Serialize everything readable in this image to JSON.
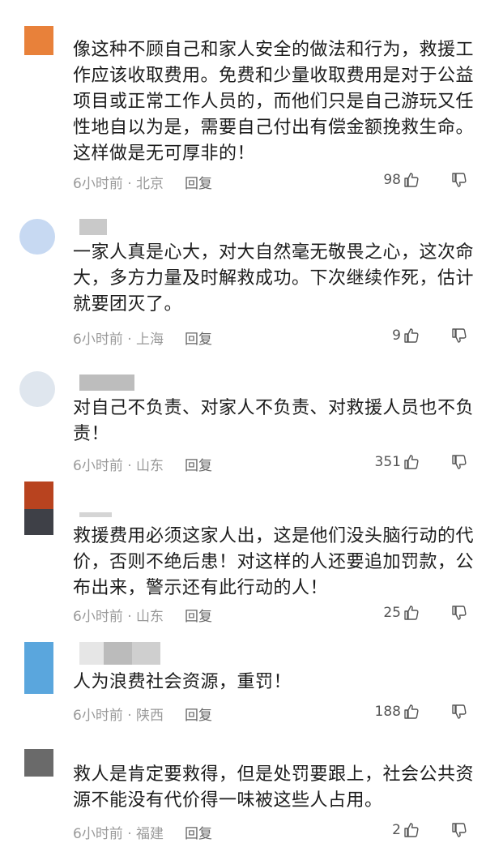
{
  "comments": [
    {
      "text": "像这种不顾自己和家人安全的做法和行为，救援工作应该收取费用。免费和少量收取费用是对于公益项目或正常工作人员的，而他们只是自己游玩又任性地自以为是，需要自己付出有偿金额挽救生命。这样做是无可厚非的！",
      "time_location": "6小时前 · 北京",
      "reply": "回复",
      "likes": "98",
      "avatar_color": "#e8813a"
    },
    {
      "text": "一家人真是心大，对大自然毫无敬畏之心，这次命大，多方力量及时解救成功。下次继续作死，估计就要团灭了。",
      "time_location": "6小时前 · 上海",
      "reply": "回复",
      "likes": "9",
      "avatar_color": "#c7d9f2"
    },
    {
      "text": "对自己不负责、对家人不负责、对救援人员也不负责！",
      "time_location": "6小时前 · 山东",
      "reply": "回复",
      "likes": "351",
      "avatar_color": "#dfe6ee"
    },
    {
      "text": "救援费用必须这家人出，这是他们没头脑行动的代价，否则不绝后患！对这样的人还要追加罚款，公布出来，警示还有此行动的人！",
      "time_location": "6小时前 · 山东",
      "reply": "回复",
      "likes": "25",
      "avatar_color": "#b8431f"
    },
    {
      "text": "人为浪费社会资源，重罚！",
      "time_location": "6小时前 · 陕西",
      "reply": "回复",
      "likes": "188",
      "avatar_color": "#5aa6dd"
    },
    {
      "text": "救人是肯定要救得，但是处罚要跟上，社会公共资源不能没有代价得一味被这些人占用。",
      "time_location": "6小时前 · 福建",
      "reply": "回复",
      "likes": "2",
      "avatar_color": "#6a6a6a"
    }
  ]
}
